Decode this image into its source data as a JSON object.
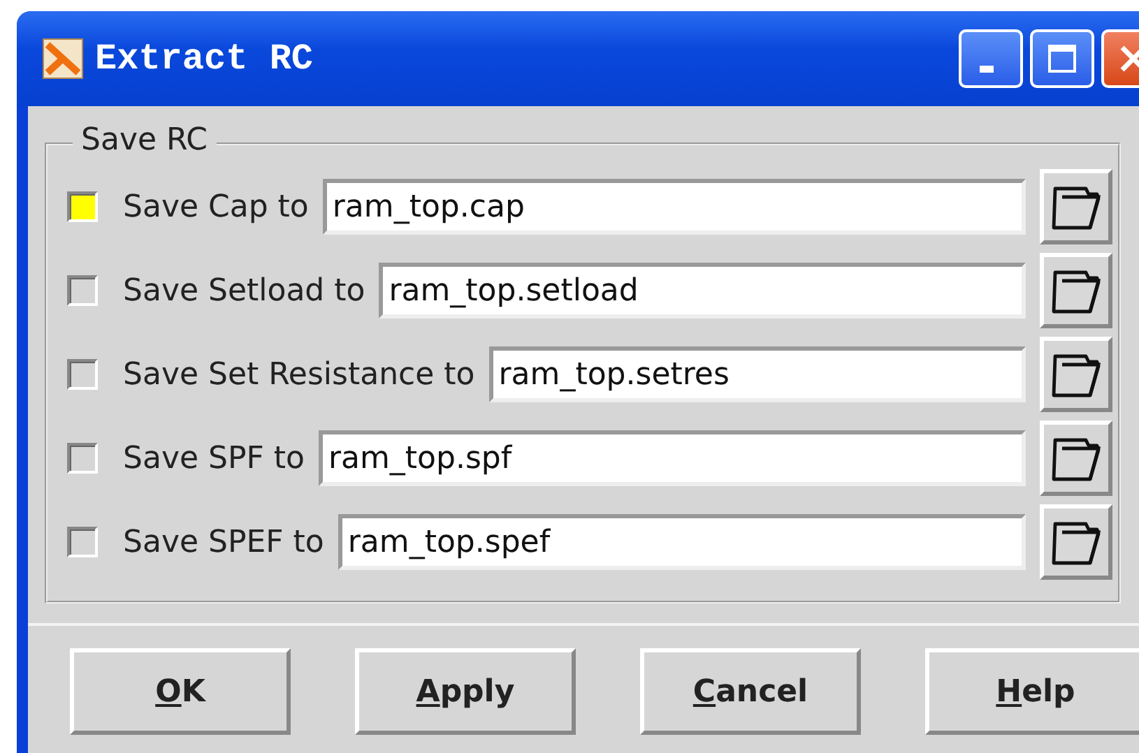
{
  "window": {
    "title": "Extract RC"
  },
  "group": {
    "title": "Save RC"
  },
  "rows": [
    {
      "label": "Save Cap to",
      "checked": true,
      "value": "ram_top.cap"
    },
    {
      "label": "Save Setload to",
      "checked": false,
      "value": "ram_top.setload"
    },
    {
      "label": "Save Set Resistance to",
      "checked": false,
      "value": "ram_top.setres"
    },
    {
      "label": "Save SPF to",
      "checked": false,
      "value": "ram_top.spf"
    },
    {
      "label": "Save SPEF to",
      "checked": false,
      "value": "ram_top.spef"
    }
  ],
  "buttons": [
    {
      "mnemonic": "O",
      "rest": "K"
    },
    {
      "mnemonic": "A",
      "rest": "pply"
    },
    {
      "mnemonic": "C",
      "rest": "ancel"
    },
    {
      "mnemonic": "H",
      "rest": "elp"
    }
  ]
}
